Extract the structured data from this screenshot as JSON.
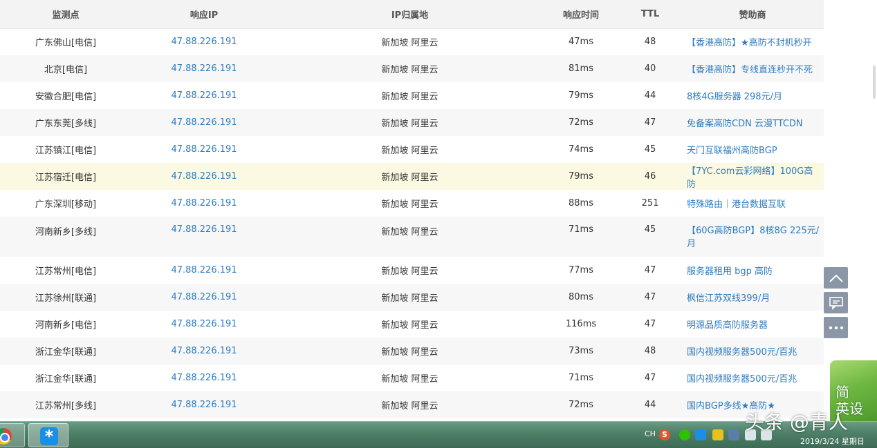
{
  "table": {
    "headers": [
      "监测点",
      "响应IP",
      "IP归属地",
      "响应时间",
      "TTL",
      "赞助商"
    ],
    "rows": [
      {
        "node": "广东佛山[电信]",
        "ip": "47.88.226.191",
        "location": "新加坡 阿里云",
        "time": "47ms",
        "ttl": "48",
        "sponsor": "【香港高防】★高防不封机秒开"
      },
      {
        "node": "北京[电信]",
        "ip": "47.88.226.191",
        "location": "新加坡 阿里云",
        "time": "81ms",
        "ttl": "40",
        "sponsor": "【香港高防】专线直连秒开不死"
      },
      {
        "node": "安徽合肥[电信]",
        "ip": "47.88.226.191",
        "location": "新加坡 阿里云",
        "time": "79ms",
        "ttl": "44",
        "sponsor": "8核4G服务器 298元/月"
      },
      {
        "node": "广东东莞[多线]",
        "ip": "47.88.226.191",
        "location": "新加坡 阿里云",
        "time": "72ms",
        "ttl": "47",
        "sponsor": "免备案高防CDN 云漫TTCDN"
      },
      {
        "node": "江苏镇江[电信]",
        "ip": "47.88.226.191",
        "location": "新加坡 阿里云",
        "time": "74ms",
        "ttl": "45",
        "sponsor": "天门互联福州高防BGP"
      },
      {
        "node": "江苏宿迁[电信]",
        "ip": "47.88.226.191",
        "location": "新加坡 阿里云",
        "time": "79ms",
        "ttl": "46",
        "sponsor": "【7YC.com云彩网络】100G高防"
      },
      {
        "node": "广东深圳[移动]",
        "ip": "47.88.226.191",
        "location": "新加坡 阿里云",
        "time": "88ms",
        "ttl": "251",
        "sponsor": "特殊路由｜港台数据互联"
      },
      {
        "node": "河南新乡[多线]",
        "ip": "47.88.226.191",
        "location": "新加坡 阿里云",
        "time": "71ms",
        "ttl": "45",
        "sponsor": "【60G高防BGP】8核8G 225元/月"
      },
      {
        "node": "江苏常州[电信]",
        "ip": "47.88.226.191",
        "location": "新加坡 阿里云",
        "time": "77ms",
        "ttl": "47",
        "sponsor": "服务器租用 bgp 高防"
      },
      {
        "node": "江苏徐州[联通]",
        "ip": "47.88.226.191",
        "location": "新加坡 阿里云",
        "time": "80ms",
        "ttl": "47",
        "sponsor": "枫信江苏双线399/月"
      },
      {
        "node": "河南新乡[电信]",
        "ip": "47.88.226.191",
        "location": "新加坡 阿里云",
        "time": "116ms",
        "ttl": "47",
        "sponsor": "明源品质高防服务器"
      },
      {
        "node": "浙江金华[联通]",
        "ip": "47.88.226.191",
        "location": "新加坡 阿里云",
        "time": "73ms",
        "ttl": "48",
        "sponsor": "国内视频服务器500元/百兆"
      },
      {
        "node": "浙江金华[联通]",
        "ip": "47.88.226.191",
        "location": "新加坡 阿里云",
        "time": "71ms",
        "ttl": "47",
        "sponsor": "国内视频服务器500元/百兆"
      },
      {
        "node": "江苏常州[多线]",
        "ip": "47.88.226.191",
        "location": "新加坡 阿里云",
        "time": "72ms",
        "ttl": "44",
        "sponsor": "国内BGP多线★高防★"
      }
    ]
  },
  "side_tools": {
    "icons": [
      "chevron-up-icon",
      "comment-icon",
      "more-dots-icon"
    ]
  },
  "ime_widget": {
    "line1": "简",
    "line2": "英设"
  },
  "taskbar": {
    "tray_lang": "CH",
    "sogou_glyph": "S",
    "star_glyph": "*",
    "date": "2019/3/24 星期日"
  },
  "watermark": "头条 @青人",
  "colors": {
    "link": "#2e7bc0",
    "header_bg": "#f3f3f3",
    "highlight_row": "#fbf9e1",
    "side_button": "#8b97a6"
  }
}
